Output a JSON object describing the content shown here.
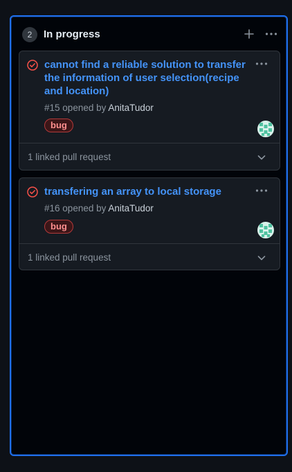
{
  "column": {
    "count": "2",
    "title": "In progress",
    "add_icon": "plus-icon",
    "menu_icon": "kebab-horizontal-icon",
    "accent_color": "#1f6feb"
  },
  "cards": [
    {
      "status_icon": "issue-opened-icon",
      "title": "cannot find a reliable solution to transfer the information of user selection(recipe and location)",
      "number": "#15",
      "opened_by_text": "opened by",
      "author": "AnitaTudor",
      "label": "bug",
      "linked_text": "1 linked pull request"
    },
    {
      "status_icon": "issue-opened-icon",
      "title": "transfering an array to local storage",
      "number": "#16",
      "opened_by_text": "opened by",
      "author": "AnitaTudor",
      "label": "bug",
      "linked_text": "1 linked pull request"
    }
  ],
  "colors": {
    "title_link": "#4493f8",
    "issue_icon": "#f85149",
    "label_bug_text": "#ff8f8f",
    "label_bug_border": "#b33a3a"
  }
}
